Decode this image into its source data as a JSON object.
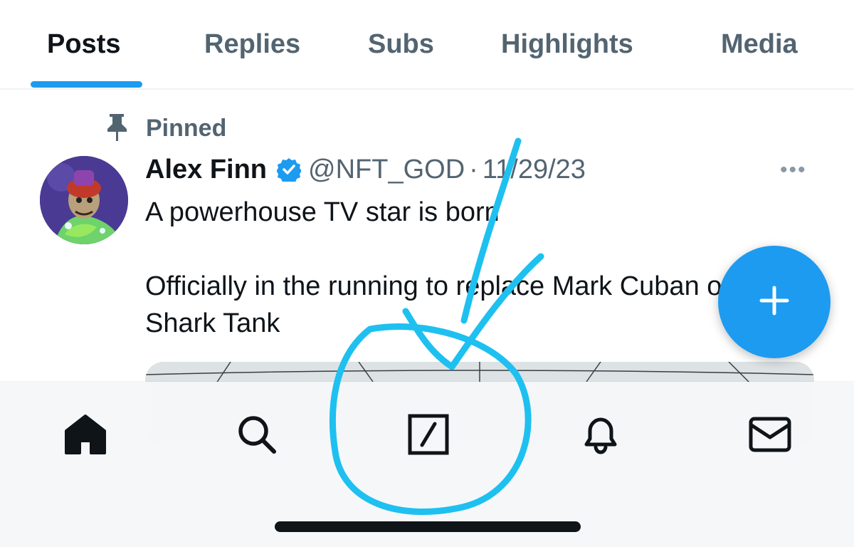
{
  "tabs": [
    {
      "label": "Posts",
      "active": true
    },
    {
      "label": "Replies",
      "active": false
    },
    {
      "label": "Subs",
      "active": false
    },
    {
      "label": "Highlights",
      "active": false
    },
    {
      "label": "Media",
      "active": false
    }
  ],
  "pinned": {
    "label": "Pinned",
    "icon": "pin-icon"
  },
  "post": {
    "author": "Alex Finn",
    "verified": true,
    "handle": "@NFT_GOD",
    "separator": "·",
    "date": "11/29/23",
    "more": "•••",
    "lines": [
      "A powerhouse TV star is born",
      "Officially in the running to replace Mark Cuban on",
      "Shark Tank"
    ]
  },
  "fab": {
    "icon": "plus-icon"
  },
  "bottom_nav": [
    {
      "name": "nav-home",
      "icon": "home-icon",
      "active": true
    },
    {
      "name": "nav-search",
      "icon": "search-icon",
      "active": false
    },
    {
      "name": "nav-grok",
      "icon": "grok-icon",
      "active": false
    },
    {
      "name": "nav-notifications",
      "icon": "bell-icon",
      "active": false
    },
    {
      "name": "nav-messages",
      "icon": "mail-icon",
      "active": false
    }
  ],
  "colors": {
    "accent": "#1d9bf0",
    "text_primary": "#0f1419",
    "text_secondary": "#536471",
    "annotation": "#1ec0f0"
  }
}
